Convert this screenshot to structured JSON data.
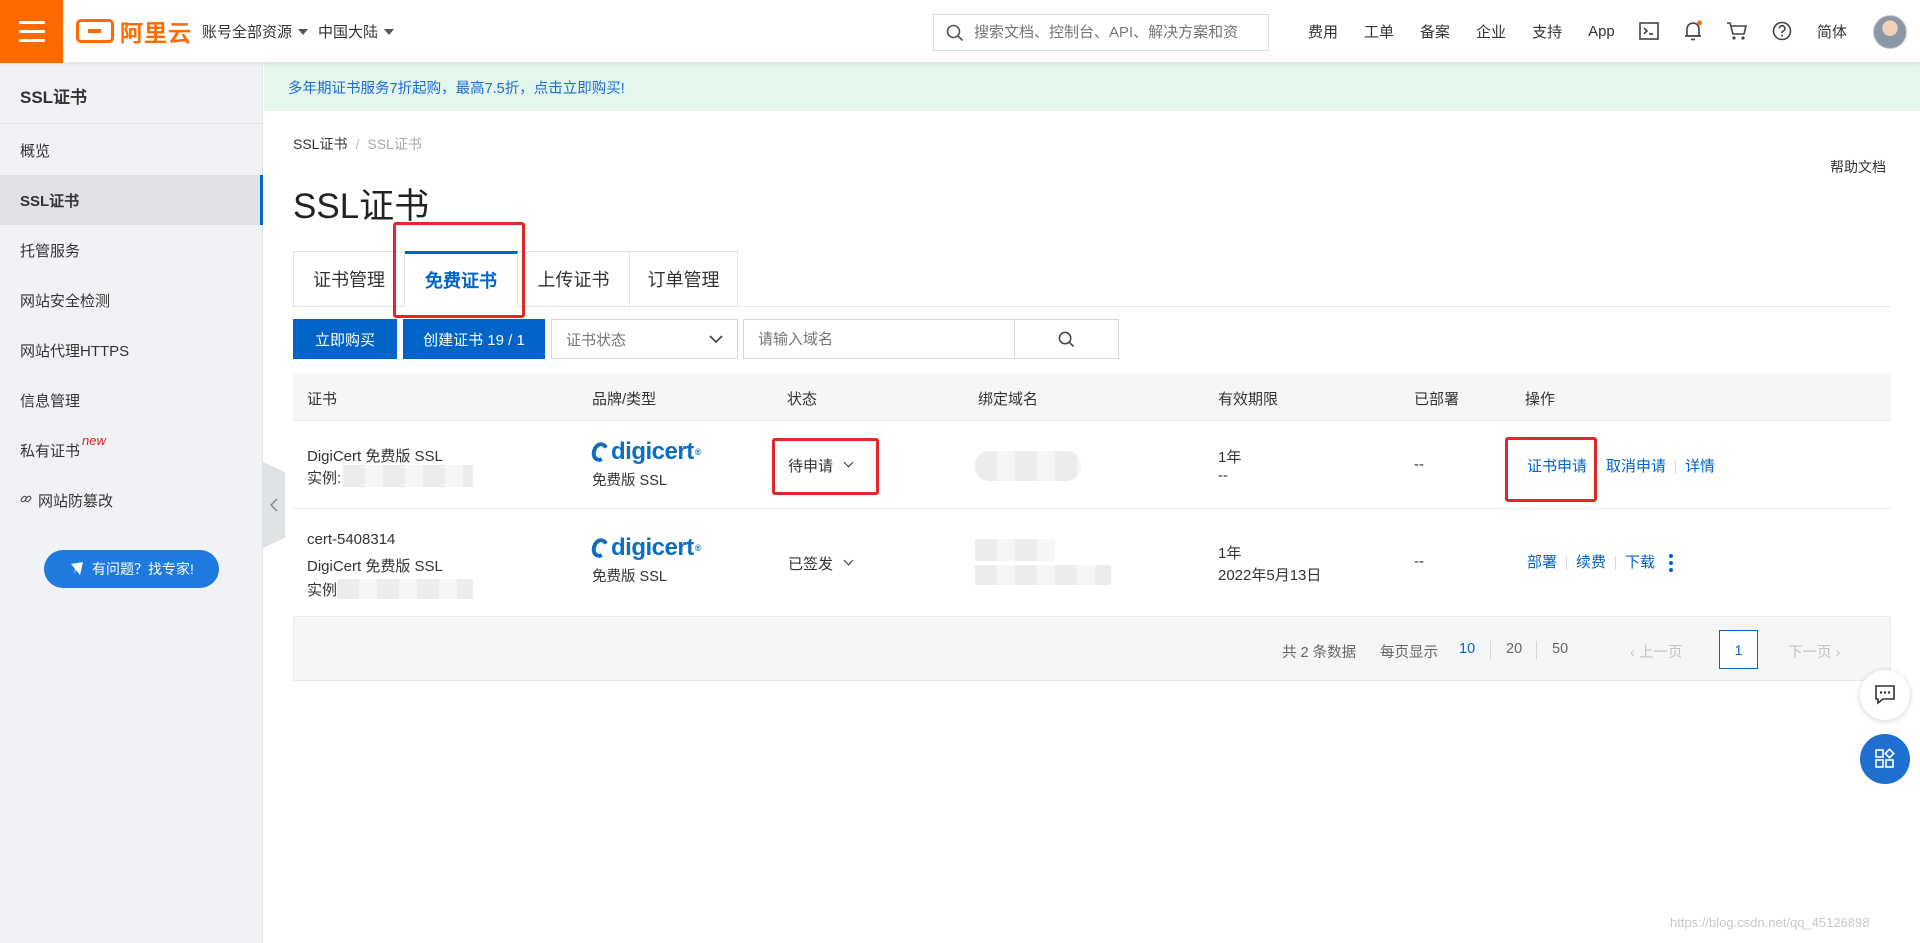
{
  "topbar": {
    "logo_text": "阿里云",
    "account_scope": "账号全部资源",
    "region": "中国大陆",
    "search_placeholder": "搜索文档、控制台、API、解决方案和资",
    "links": [
      "费用",
      "工单",
      "备案",
      "企业",
      "支持",
      "App"
    ],
    "language": "简体",
    "icons": [
      "terminal-icon",
      "bell-icon",
      "cart-icon",
      "question-icon"
    ],
    "accent_color": "#ff6a00"
  },
  "sidebar": {
    "title": "SSL证书",
    "items": [
      {
        "label": "概览"
      },
      {
        "label": "SSL证书",
        "active": true
      },
      {
        "label": "托管服务"
      },
      {
        "label": "网站安全检测"
      },
      {
        "label": "网站代理HTTPS"
      },
      {
        "label": "信息管理"
      },
      {
        "label": "私有证书",
        "badge": "new"
      },
      {
        "label": "网站防篡改",
        "icon": "link-icon"
      }
    ],
    "help_button": "有问题？找专家!"
  },
  "banner": {
    "text": "多年期证书服务7折起购，最高7.5折，点击立即购买!"
  },
  "breadcrumb": [
    "SSL证书",
    "SSL证书"
  ],
  "help_doc": "帮助文档",
  "page_title": "SSL证书",
  "tabs": [
    {
      "label": "证书管理"
    },
    {
      "label": "免费证书",
      "active": true
    },
    {
      "label": "上传证书"
    },
    {
      "label": "订单管理"
    }
  ],
  "toolbar": {
    "buy_label": "立即购买",
    "create_label": "创建证书 19 / 1",
    "status_placeholder": "证书状态",
    "domain_placeholder": "请输入域名"
  },
  "table": {
    "columns": [
      "证书",
      "品牌/类型",
      "状态",
      "绑定域名",
      "有效期限",
      "已部署",
      "操作"
    ],
    "rows": [
      {
        "cert_id": "",
        "cert_name": "DigiCert 免费版 SSL",
        "instance_label": "实例:",
        "brand": "digicert",
        "brand_type": "免费版 SSL",
        "status": "待申请",
        "validity": "1年",
        "expiry": "--",
        "deployed": "--",
        "actions": [
          "证书申请",
          "取消申请",
          "详情"
        ]
      },
      {
        "cert_id": "cert-5408314",
        "cert_name": "DigiCert 免费版 SSL",
        "instance_label": "实例",
        "brand": "digicert",
        "brand_type": "免费版 SSL",
        "status": "已签发",
        "validity": "1年",
        "expiry": "2022年5月13日",
        "deployed": "--",
        "actions": [
          "部署",
          "续费",
          "下载"
        ]
      }
    ]
  },
  "pagination": {
    "total_text": "共 2 条数据",
    "page_size_label": "每页显示",
    "page_sizes": [
      "10",
      "20",
      "50"
    ],
    "prev": "上一页",
    "next": "下一页",
    "current_page": "1"
  },
  "watermark": "https://blog.csdn.net/qq_45126898"
}
